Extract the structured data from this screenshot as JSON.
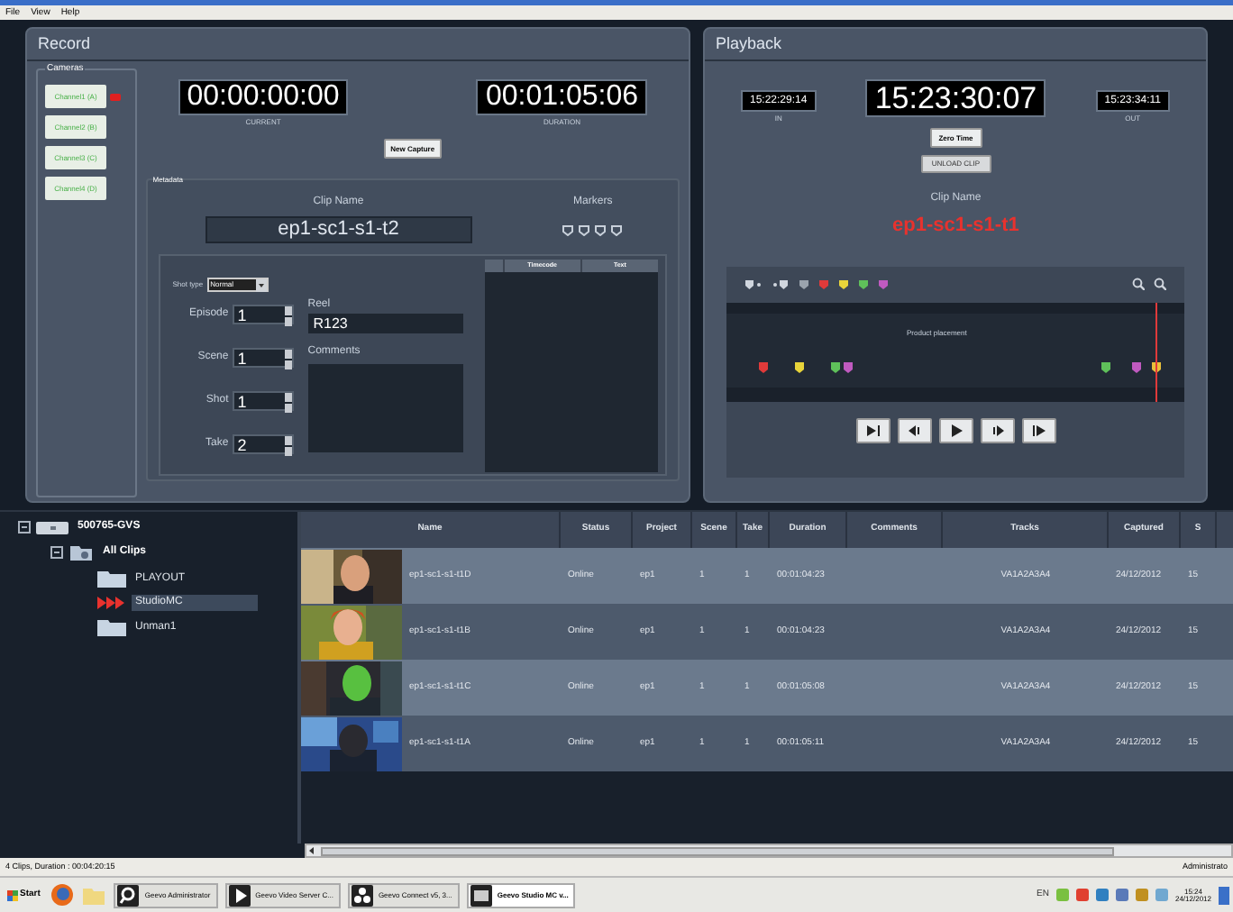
{
  "menu": [
    "File",
    "View",
    "Help"
  ],
  "record": {
    "title": "Record",
    "cameras_label": "Cameras",
    "cameras": [
      {
        "label": "Channel1 (A)",
        "recording": true
      },
      {
        "label": "Channel2 (B)",
        "recording": false
      },
      {
        "label": "Channel3 (C)",
        "recording": false
      },
      {
        "label": "Channel4 (D)",
        "recording": false
      }
    ],
    "current": {
      "value": "00:00:00:00",
      "label": "CURRENT"
    },
    "duration": {
      "value": "00:01:05:06",
      "label": "DURATION"
    },
    "new_capture": "New Capture",
    "metadata": {
      "title": "Metadata",
      "clip_name_label": "Clip Name",
      "clip_name": "ep1-sc1-s1-t2",
      "markers_label": "Markers",
      "shot_type_label": "Shot type",
      "shot_type": "Normal",
      "fields": [
        {
          "label": "Episode",
          "value": "1"
        },
        {
          "label": "Scene",
          "value": "1"
        },
        {
          "label": "Shot",
          "value": "1"
        },
        {
          "label": "Take",
          "value": "2"
        }
      ],
      "reel_label": "Reel",
      "reel": "R123",
      "comments_label": "Comments",
      "marker_columns": [
        "Timecode",
        "Text"
      ]
    }
  },
  "playback": {
    "title": "Playback",
    "in": {
      "value": "15:22:29:14",
      "label": "IN"
    },
    "position": "15:23:30:07",
    "out": {
      "value": "15:23:34:11",
      "label": "OUT"
    },
    "zero_time": "Zero Time",
    "unload": "UNLOAD CLIP",
    "clip_name_label": "Clip Name",
    "clip_name": "ep1-sc1-s1-t1",
    "timeline": {
      "label": "Product placement",
      "markers": [
        {
          "color": "#e03a3a"
        },
        {
          "color": "#e8d43a"
        },
        {
          "color": "#5fc05a"
        },
        {
          "color": "#c05ac0"
        },
        {
          "color": "#5fc05a"
        },
        {
          "color": "#c05ac0"
        },
        {
          "color": "#e8c03a"
        }
      ]
    }
  },
  "tree": {
    "label": "500765-GVS",
    "expanded": true,
    "children": [
      {
        "label": "All Clips",
        "expanded": true,
        "children": [
          {
            "label": "PLAYOUT",
            "selected": false
          },
          {
            "label": "StudioMC",
            "selected": true
          },
          {
            "label": "Unman1",
            "selected": false
          }
        ]
      }
    ]
  },
  "clips": {
    "columns": [
      "Name",
      "Status",
      "Project",
      "Scene",
      "Take",
      "Duration",
      "Comments",
      "Tracks",
      "Captured",
      "S"
    ],
    "rows": [
      {
        "cells": [
          "ep1-sc1-s1-t1D",
          "Online",
          "ep1",
          "1",
          "1",
          "00:01:04:23",
          "",
          "VA1A2A3A4",
          "24/12/2012",
          "15"
        ]
      },
      {
        "cells": [
          "ep1-sc1-s1-t1B",
          "Online",
          "ep1",
          "1",
          "1",
          "00:01:04:23",
          "",
          "VA1A2A3A4",
          "24/12/2012",
          "15"
        ]
      },
      {
        "cells": [
          "ep1-sc1-s1-t1C",
          "Online",
          "ep1",
          "1",
          "1",
          "00:01:05:08",
          "",
          "VA1A2A3A4",
          "24/12/2012",
          "15"
        ]
      },
      {
        "cells": [
          "ep1-sc1-s1-t1A",
          "Online",
          "ep1",
          "1",
          "1",
          "00:01:05:11",
          "",
          "VA1A2A3A4",
          "24/12/2012",
          "15"
        ]
      }
    ]
  },
  "status_bar": {
    "left": "4 Clips, Duration : 00:04:20:15",
    "right": "Administrato"
  },
  "taskbar": {
    "start": "Start",
    "tasks": [
      {
        "label": "Geevo Administrator",
        "active": false
      },
      {
        "label": "Geevo Video Server C...",
        "active": false
      },
      {
        "label": "Geevo Connect v5, 3...",
        "active": false
      },
      {
        "label": "Geevo Studio MC v...",
        "active": true
      }
    ],
    "language": "EN",
    "time": "15:24",
    "date": "24/12/2012"
  }
}
